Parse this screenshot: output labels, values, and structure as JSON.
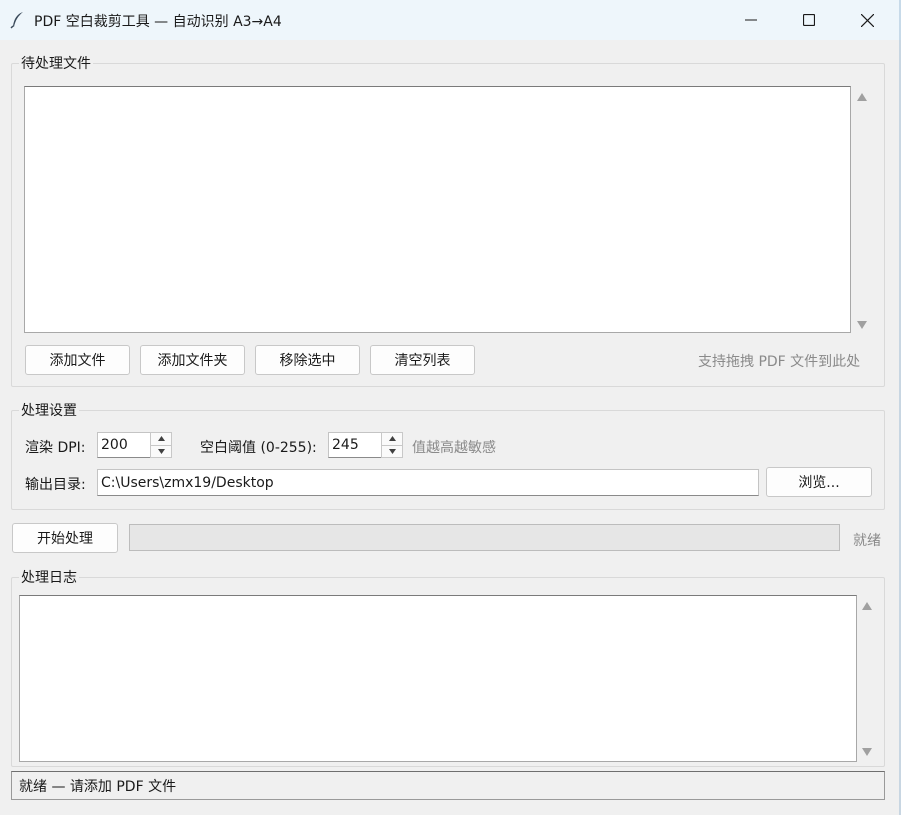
{
  "window": {
    "title": "PDF 空白裁剪工具 — 自动识别 A3→A4",
    "icon": "feather-icon",
    "controls": [
      "minimize-icon",
      "maximize-icon",
      "close-icon"
    ]
  },
  "files_group": {
    "label": "待处理文件",
    "buttons": {
      "add_file": "添加文件",
      "add_folder": "添加文件夹",
      "remove_selected": "移除选中",
      "clear_list": "清空列表"
    },
    "hint": "支持拖拽 PDF 文件到此处",
    "items": []
  },
  "settings_group": {
    "label": "处理设置",
    "dpi_label": "渲染 DPI:",
    "dpi_value": "200",
    "threshold_label": "空白阈值 (0-255):",
    "threshold_value": "245",
    "threshold_hint": "值越高越敏感",
    "output_label": "输出目录:",
    "output_value": "C:\\Users\\zmx19/Desktop",
    "browse_label": "浏览..."
  },
  "process": {
    "start_label": "开始处理",
    "progress": 0,
    "status": "就绪"
  },
  "log_group": {
    "label": "处理日志",
    "lines": []
  },
  "statusbar": {
    "text": "就绪 — 请添加 PDF 文件"
  },
  "colors": {
    "window_bg": "#f0f0f0",
    "titlebar_bg": "#eef6fb",
    "hint_text": "#8a8a8a",
    "progress_trough": "#e6e6e6"
  }
}
